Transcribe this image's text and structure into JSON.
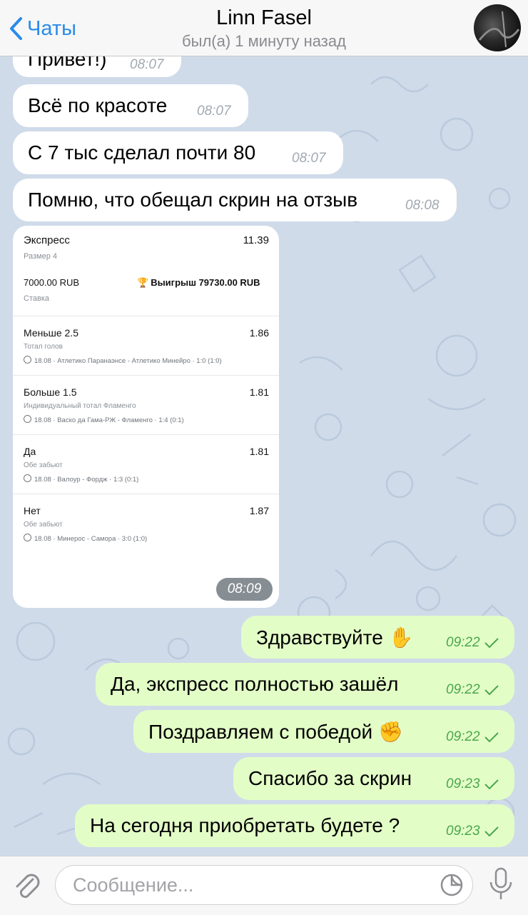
{
  "header": {
    "back_label": "Чаты",
    "contact_name": "Linn Fasel",
    "status": "был(а) 1 минуту назад"
  },
  "incoming": [
    {
      "text": "Привет!)",
      "time": "08:07"
    },
    {
      "text": "Всё по красоте",
      "time": "08:07"
    },
    {
      "text": "С 7 тыс сделал почти 80",
      "time": "08:07"
    },
    {
      "text": "Помню, что обещал скрин на отзыв",
      "time": "08:08"
    }
  ],
  "screenshot": {
    "time": "08:09",
    "title": "Экспресс",
    "total_odds": "11.39",
    "size": "Размер 4",
    "stake": "7000.00 RUB",
    "stake_label": "Ставка",
    "win": "Выигрыш 79730.00 RUB",
    "bets": [
      {
        "name": "Меньше 2.5",
        "odd": "1.86",
        "market": "Тотал голов",
        "match": "18.08 · Атлетико Паранаэнсе - Атлетико Минейро · 1:0 (1:0)"
      },
      {
        "name": "Больше 1.5",
        "odd": "1.81",
        "market": "Индивидуальный тотал Фламенго",
        "match": "18.08 · Васко да Гама-РЖ - Фламенго · 1:4 (0:1)"
      },
      {
        "name": "Да",
        "odd": "1.81",
        "market": "Обе забьют",
        "match": "18.08 · Валоур - Фордж · 1:3 (0:1)"
      },
      {
        "name": "Нет",
        "odd": "1.87",
        "market": "Обе забьют",
        "match": "18.08 · Минерос - Самора · 3:0 (1:0)"
      }
    ]
  },
  "outgoing": [
    {
      "text": "Здравствуйте ✋",
      "time": "09:22"
    },
    {
      "text": "Да, экспресс полностью зашёл",
      "time": "09:22"
    },
    {
      "text": "Поздравляем с победой ✊",
      "time": "09:22"
    },
    {
      "text": "Спасибо за скрин",
      "time": "09:23"
    },
    {
      "text": "На сегодня приобретать будете ?",
      "time": "09:23"
    }
  ],
  "input": {
    "placeholder": "Сообщение..."
  },
  "colors": {
    "accent": "#2a8bea",
    "outgoing_bubble": "#e3fdc7",
    "incoming_bubble": "#ffffff",
    "wallpaper": "#cfdbe9",
    "read_check": "#4aa74c"
  }
}
